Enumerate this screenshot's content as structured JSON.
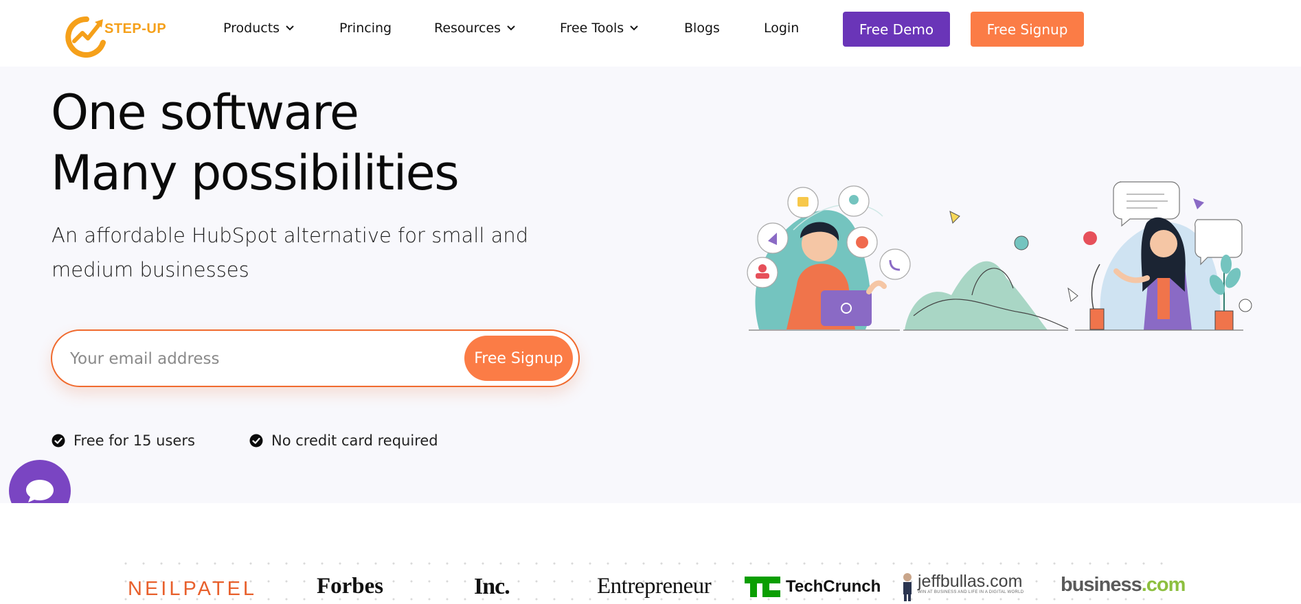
{
  "header": {
    "logo_text": "STEP-UP",
    "nav": [
      {
        "label": "Products",
        "dropdown": true
      },
      {
        "label": "Princing",
        "dropdown": false
      },
      {
        "label": "Resources",
        "dropdown": true
      },
      {
        "label": "Free Tools",
        "dropdown": true
      },
      {
        "label": "Blogs",
        "dropdown": false
      },
      {
        "label": "Login",
        "dropdown": false
      }
    ],
    "demo_button": "Free Demo",
    "signup_button": "Free Signup"
  },
  "hero": {
    "headline_line1": "One software",
    "headline_line2": "Many possibilities",
    "subheading": "An affordable HubSpot alternative for small and medium businesses",
    "email_placeholder": "Your email address",
    "email_value": "",
    "form_button": "Free Signup",
    "checks": [
      "Free for 15 users",
      "No credit card required"
    ]
  },
  "press": {
    "neilpatel": "NEILPATEL",
    "forbes": "Forbes",
    "inc": "Inc.",
    "entrepreneur": "Entrepreneur",
    "techcrunch": "TechCrunch",
    "jeffbullas": "jeffbullas.com",
    "jeffbullas_tagline": "WIN AT BUSINESS AND LIFE IN A DIGITAL WORLD",
    "business_main": "business",
    "business_com": ".com"
  },
  "colors": {
    "brand_orange": "#fb7c46",
    "brand_purple": "#6a35b8",
    "logo_gold": "#f5a01a",
    "hero_bg": "#f8f8fc"
  },
  "icons": [
    "step-up-logo-icon",
    "chevron-down-icon",
    "check-circle-icon",
    "chat-icon"
  ]
}
